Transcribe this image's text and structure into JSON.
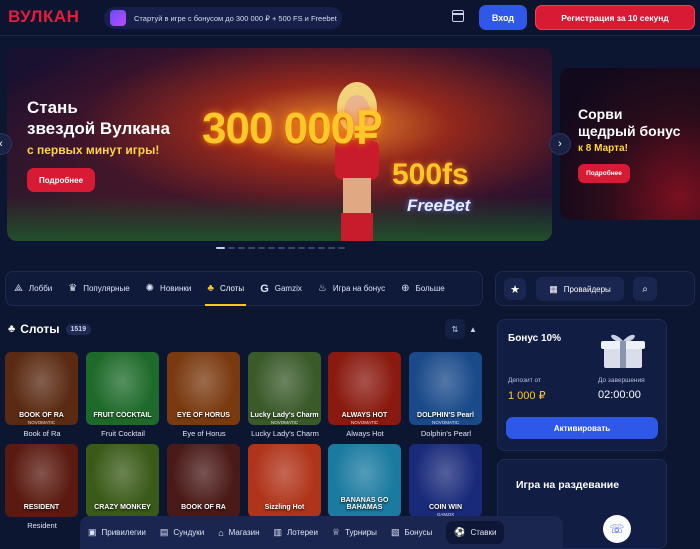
{
  "header": {
    "logo": "ВУЛКАН",
    "promo_text": "Стартуй в игре с бонусом до 300 000 ₽ + 500 FS и Freebet",
    "login_label": "Вход",
    "register_label": "Регистрация за 10 секунд"
  },
  "hero": {
    "title_line1": "Стань",
    "title_line2": "звездой Вулкана",
    "subtitle": "с первых минут игры!",
    "more_label": "Подробнее",
    "amount": "300 000₽",
    "fs": "500fs",
    "freebet": "FreeBet"
  },
  "hero2": {
    "title_line1": "Сорви",
    "title_line2": "щедрый бонус",
    "subtitle": "к 8 Марта!",
    "more_label": "Подробнее"
  },
  "nav": {
    "items": [
      {
        "label": "Лобби",
        "icon": "lobby-icon"
      },
      {
        "label": "Популярные",
        "icon": "crown-icon"
      },
      {
        "label": "Новинки",
        "icon": "new-icon"
      },
      {
        "label": "Слоты",
        "icon": "slots-icon"
      },
      {
        "label": "Gamzix",
        "icon": "gamzix-icon"
      },
      {
        "label": "Игра на бонус",
        "icon": "fire-icon"
      },
      {
        "label": "Больше",
        "icon": "more-icon"
      }
    ],
    "providers_label": "Провайдеры"
  },
  "slots": {
    "title": "Слоты",
    "count": "1519",
    "games_row1": [
      {
        "name": "Book of Ra",
        "art": "BOOK OF RA",
        "provider": "NOVOMATIC",
        "bg": "#5a2a12"
      },
      {
        "name": "Fruit Cocktail",
        "art": "FRUIT COCKTAIL",
        "provider": "",
        "bg": "#1e6a2a"
      },
      {
        "name": "Eye of Horus",
        "art": "EYE OF HORUS",
        "provider": "",
        "bg": "#7a3a10"
      },
      {
        "name": "Lucky Lady's Charm",
        "art": "Lucky Lady's Charm",
        "provider": "NOVOMATIC",
        "bg": "#3a5a2a"
      },
      {
        "name": "Always Hot",
        "art": "ALWAYS HOT",
        "provider": "NOVOMATIC",
        "bg": "#8a1a10"
      },
      {
        "name": "Dolphin's Pearl",
        "art": "DOLPHIN'S Pearl",
        "provider": "NOVOMATIC",
        "bg": "#1a4a8a"
      }
    ],
    "games_row2": [
      {
        "name": "Resident",
        "art": "RESIDENT",
        "provider": "",
        "bg": "#5a1a10"
      },
      {
        "name": "",
        "art": "CRAZY MONKEY",
        "provider": "",
        "bg": "#3a5a18"
      },
      {
        "name": "",
        "art": "BOOK OF RA",
        "provider": "",
        "bg": "#4a1a18"
      },
      {
        "name": "",
        "art": "Sizzling Hot",
        "provider": "",
        "bg": "#b0341a"
      },
      {
        "name": "",
        "art": "BANANAS GO BAHAMAS",
        "provider": "",
        "bg": "#1a7aa0"
      },
      {
        "name": "",
        "art": "COIN WIN",
        "provider": "GAMZIX",
        "bg": "#1a2a7a"
      }
    ]
  },
  "bonus": {
    "title": "Бонус 10%",
    "deposit_label": "Депозит от",
    "deposit_value": "1 000 ₽",
    "timer_label": "До завершения",
    "timer_value": "02:00:00",
    "activate_label": "Активировать"
  },
  "strip": {
    "title": "Игра на раздевание"
  },
  "bottom_bar": {
    "items": [
      {
        "label": "Привилегии",
        "icon": "privilege-icon"
      },
      {
        "label": "Сундуки",
        "icon": "chest-icon"
      },
      {
        "label": "Магазин",
        "icon": "shop-icon"
      },
      {
        "label": "Лотереи",
        "icon": "lottery-icon"
      },
      {
        "label": "Турниры",
        "icon": "trophy-icon"
      },
      {
        "label": "Бонусы",
        "icon": "bonus-icon"
      },
      {
        "label": "Ставки",
        "icon": "ball-icon"
      }
    ]
  },
  "colors": {
    "accent_red": "#d81a34",
    "accent_blue": "#2f57e8",
    "gold": "#ffc82a",
    "background": "#0d1630"
  }
}
